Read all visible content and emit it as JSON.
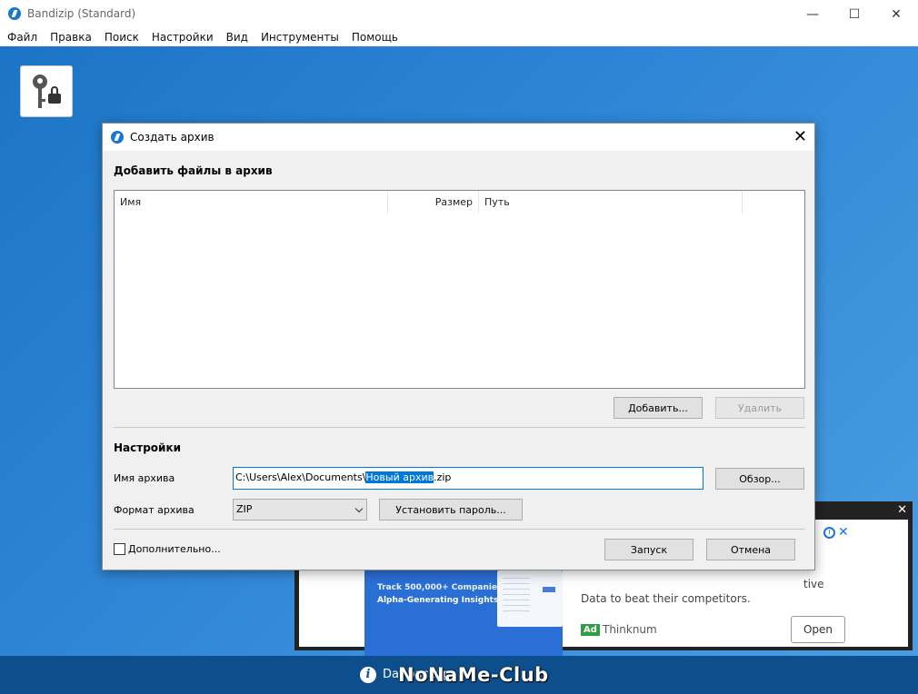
{
  "window": {
    "title": "Bandizip (Standard)",
    "controls": {
      "minimize": "—",
      "maximize": "☐",
      "close": "✕"
    }
  },
  "menu": [
    "Файл",
    "Правка",
    "Поиск",
    "Настройки",
    "Вид",
    "Инструменты",
    "Помощь"
  ],
  "dialog": {
    "title": "Создать архив",
    "close": "✕",
    "add_files_heading": "Добавить файлы в архив",
    "columns": [
      "Имя",
      "Размер",
      "Путь"
    ],
    "add_button": "Добавить...",
    "delete_button": "Удалить",
    "settings_heading": "Настройки",
    "archive_name_label": "Имя архива",
    "archive_path_prefix": "C:\\Users\\Alex\\Documents\\",
    "archive_path_selected": "Новый архив",
    "archive_path_suffix": ".zip",
    "browse_button": "Обзор...",
    "format_label": "Формат архива",
    "format_value": "ZIP",
    "set_password_button": "Установить пароль...",
    "advanced_label": "Дополнительно...",
    "advanced_checked": false,
    "start_button": "Запуск",
    "cancel_button": "Отмена"
  },
  "ad": {
    "close": "✕",
    "image_line1": "Track 500,000+ Companies",
    "image_line2": "Alpha-Generating Insights",
    "image_line3": "tive",
    "text": "Data to beat their competitors.",
    "badge": "Ad",
    "advertiser": "Thinknum",
    "open_button": "Open"
  },
  "status": {
    "text": "Dat              backup",
    "watermark": "NoNaMe-Club"
  }
}
